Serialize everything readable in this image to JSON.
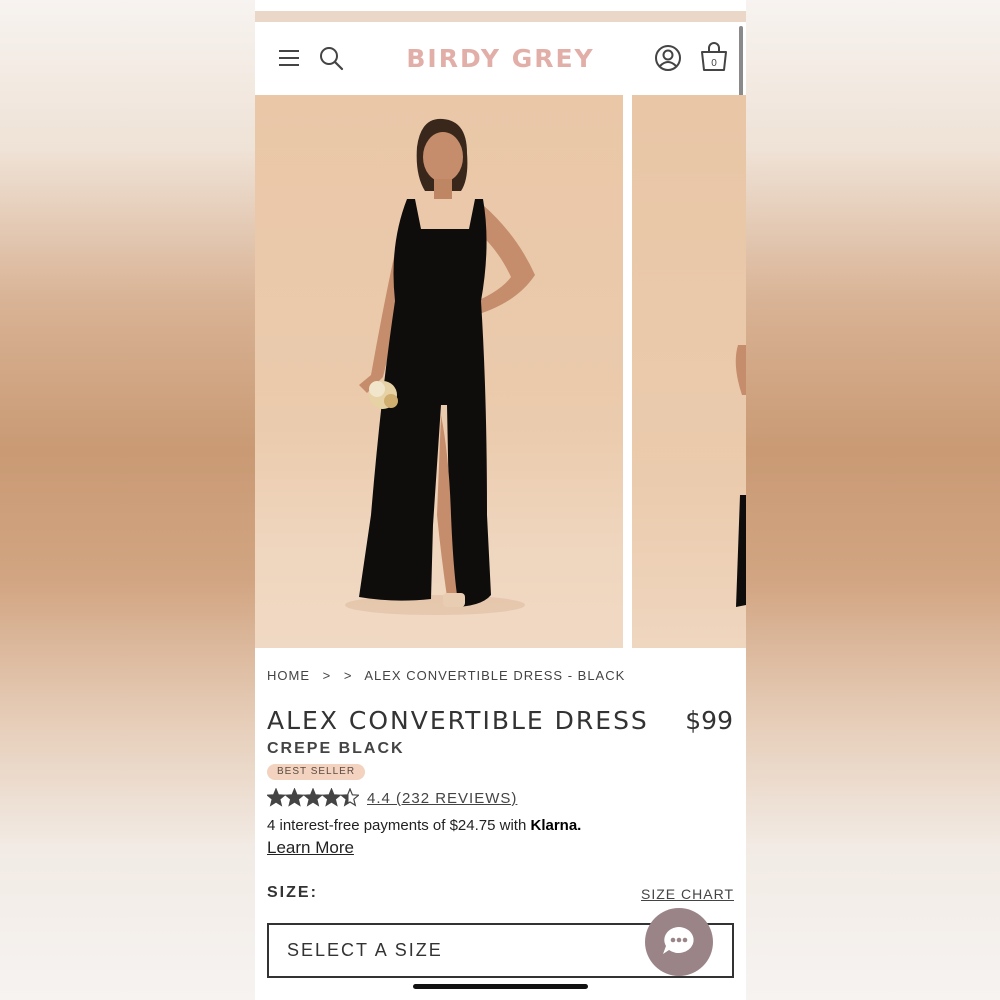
{
  "header": {
    "logo": "BIRDY GREY",
    "cart_count": "0"
  },
  "top_strip": {
    "partial_text": "... ."
  },
  "breadcrumb": {
    "home": "HOME",
    "sep1": ">",
    "sep2": ">",
    "current": "ALEX CONVERTIBLE DRESS - BLACK"
  },
  "product": {
    "title": "ALEX CONVERTIBLE DRESS",
    "price": "$99",
    "subtitle": "CREPE BLACK",
    "badge": "BEST SELLER",
    "rating": 4.4,
    "rating_text": "4.4 (232 REVIEWS)",
    "klarna_text": "4 interest-free payments of $24.75 with",
    "klarna_brand": "Klarna.",
    "learn_more": "Learn More"
  },
  "size": {
    "label": "SIZE:",
    "chart_link": "SIZE CHART",
    "placeholder": "SELECT A SIZE"
  },
  "colors": {
    "brand_pink": "#e2aea8",
    "badge_bg": "#f3d3bf",
    "chat_bg": "#9a8488",
    "photo_bg": "#e9c7a7"
  },
  "icons": [
    "menu-icon",
    "search-icon",
    "account-icon",
    "bag-icon",
    "star-icon",
    "chat-icon"
  ]
}
